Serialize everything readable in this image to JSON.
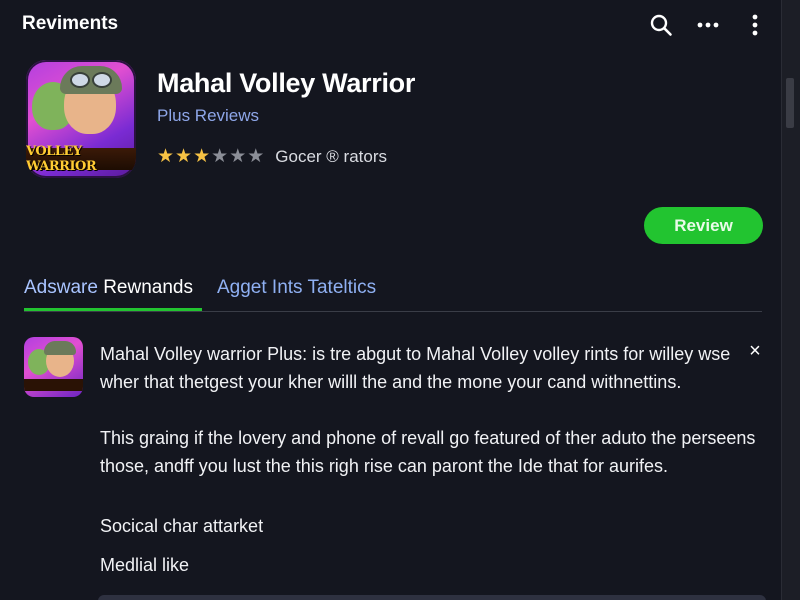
{
  "topbar": {
    "title": "Reviments",
    "icons": [
      "search-icon",
      "more-horizontal-icon",
      "more-vertical-icon"
    ]
  },
  "app": {
    "name": "Mahal Volley Warrior",
    "subtitle": "Plus Reviews",
    "icon_label": "VOLLEY WARRIOR",
    "rating_stars": 3,
    "rating_max": 6,
    "rating_text": "Gocer ® rators"
  },
  "review_button": {
    "label": "Review"
  },
  "tabs": [
    {
      "label_a": "Adsware",
      "label_b": "Rewnands",
      "active": true
    },
    {
      "label": "Agget Ints Tateltics",
      "active": false
    }
  ],
  "card": {
    "paragraph_1": "Mahal Volley warrior Plus: is tre abgut to Mahal Volley volley rints for willey wse wher that thetgest your kher willl the and the mone your cand withnettins.",
    "paragraph_2": "This graing if the lovery and phone of revall go featured of ther aduto the perseens those, andff you lust the this righ rise can paront the Ide that for aurifes.",
    "line_3": "Socical char attarket",
    "line_4": "Medlial like",
    "close_glyph": "×"
  },
  "colors": {
    "background": "#14161f",
    "accent_green": "#22c430",
    "link_blue": "#8ea6e8",
    "star_on": "#f6c244",
    "star_off": "#8b8e97"
  }
}
